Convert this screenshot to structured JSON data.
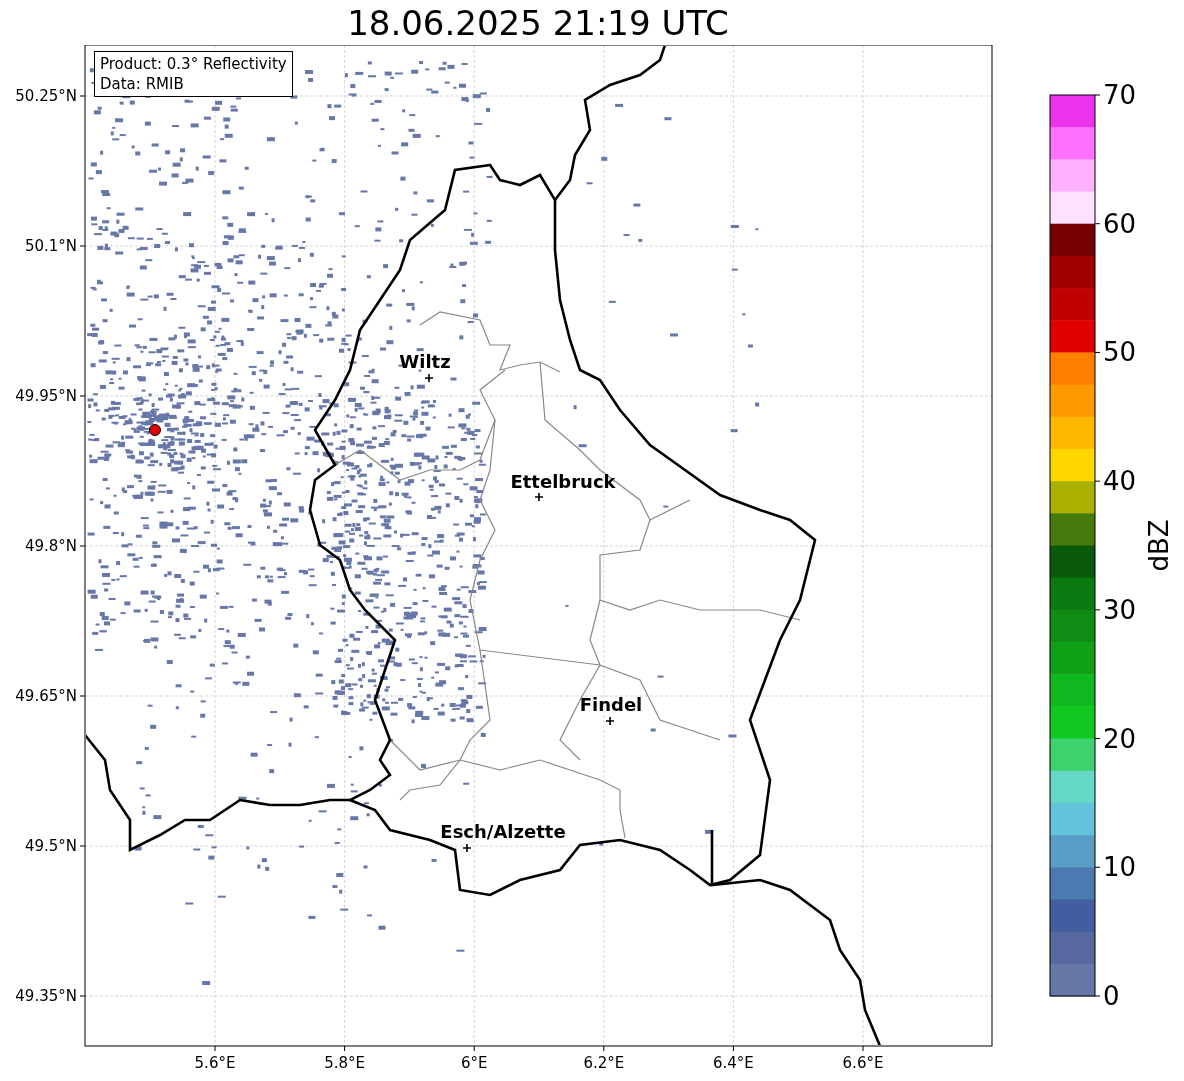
{
  "title": "18.06.2025 21:19 UTC",
  "info_box": [
    "Product: 0.3° Reflectivity",
    "Data: RMIB"
  ],
  "map": {
    "lat_ticks": [
      "50.25°N",
      "50.1°N",
      "49.95°N",
      "49.8°N",
      "49.65°N",
      "49.5°N",
      "49.35°N"
    ],
    "lon_ticks": [
      "5.6°E",
      "5.8°E",
      "6°E",
      "6.2°E",
      "6.4°E",
      "6.6°E"
    ],
    "cities": [
      {
        "name": "Wiltz"
      },
      {
        "name": "Ettelbruck"
      },
      {
        "name": "Findel"
      },
      {
        "name": "Esch/Alzette"
      }
    ]
  },
  "colorbar": {
    "label": "dBZ",
    "ticks": [
      "70",
      "60",
      "50",
      "40",
      "30",
      "20",
      "10",
      "0"
    ],
    "segments": [
      {
        "color": "#ee33ee"
      },
      {
        "color": "#ff70ff"
      },
      {
        "color": "#ffb0ff"
      },
      {
        "color": "#ffe0ff"
      },
      {
        "color": "#780000"
      },
      {
        "color": "#a00000"
      },
      {
        "color": "#c00000"
      },
      {
        "color": "#e00000"
      },
      {
        "color": "#ff7f00"
      },
      {
        "color": "#ff9900"
      },
      {
        "color": "#ffb800"
      },
      {
        "color": "#ffd700"
      },
      {
        "color": "#aab000"
      },
      {
        "color": "#467a0c"
      },
      {
        "color": "#085a0a"
      },
      {
        "color": "#0a7a10"
      },
      {
        "color": "#108c14"
      },
      {
        "color": "#10a018"
      },
      {
        "color": "#10b820"
      },
      {
        "color": "#10c820"
      },
      {
        "color": "#3ed26e"
      },
      {
        "color": "#64d8c4"
      },
      {
        "color": "#64c2dc"
      },
      {
        "color": "#5a9ec8"
      },
      {
        "color": "#4a7ab0"
      },
      {
        "color": "#425ea0"
      },
      {
        "color": "#56689f"
      },
      {
        "color": "#6677a8"
      }
    ]
  }
}
